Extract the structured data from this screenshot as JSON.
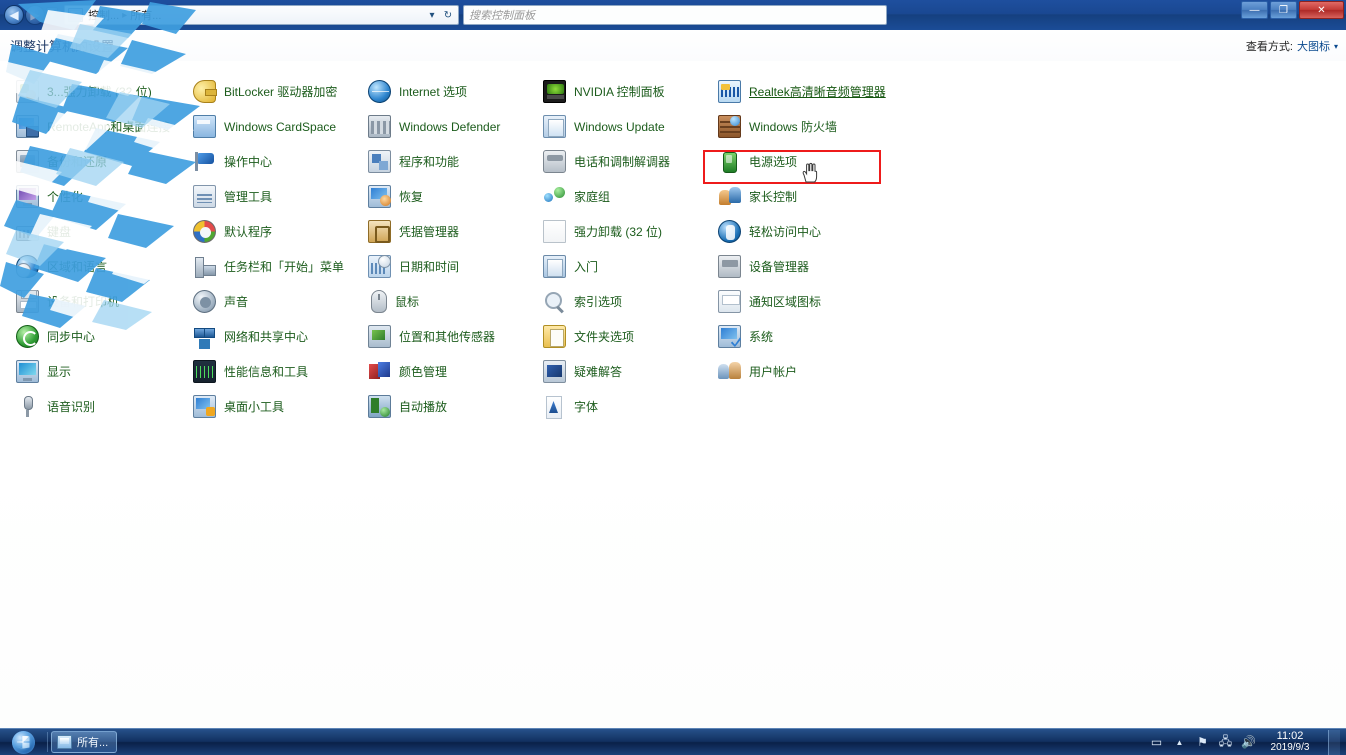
{
  "window": {
    "nav": {
      "back_icon": "back-arrow-icon",
      "forward_icon": "forward-arrow-icon",
      "recent_icon": "recent-pages-icon"
    },
    "breadcrumb": {
      "root": "控制...",
      "sep": "▸",
      "current": "所有..."
    },
    "search": {
      "placeholder": "搜索控制面板"
    },
    "controls": {
      "minimize": "—",
      "maximize": "❐",
      "close": "✕"
    }
  },
  "header": {
    "page_title": "调整计算机的设置",
    "view_by_label": "查看方式:",
    "view_by_value": "大图标",
    "view_by_caret": "▾"
  },
  "columns": [
    {
      "items": [
        {
          "label": "3...强力卸载 (32 位)",
          "icon": "uninstall-icon"
        },
        {
          "label": "RemoteApp和桌面连接",
          "icon": "remoteapp-icon"
        },
        {
          "label": "备份和还原",
          "icon": "backup-icon"
        },
        {
          "label": "个性化",
          "icon": "personalization-icon"
        },
        {
          "label": "键盘",
          "icon": "keyboard-icon"
        },
        {
          "label": "区域和语言",
          "icon": "region-language-icon"
        },
        {
          "label": "设备和打印机",
          "icon": "devices-printers-icon"
        },
        {
          "label": "同步中心",
          "icon": "sync-center-icon"
        },
        {
          "label": "显示",
          "icon": "display-icon"
        },
        {
          "label": "语音识别",
          "icon": "speech-recognition-icon"
        }
      ]
    },
    {
      "items": [
        {
          "label": "BitLocker 驱动器加密",
          "icon": "bitlocker-icon"
        },
        {
          "label": "Windows CardSpace",
          "icon": "cardspace-icon"
        },
        {
          "label": "操作中心",
          "icon": "action-center-icon"
        },
        {
          "label": "管理工具",
          "icon": "admin-tools-icon"
        },
        {
          "label": "默认程序",
          "icon": "default-programs-icon"
        },
        {
          "label": "任务栏和「开始」菜单",
          "icon": "taskbar-startmenu-icon"
        },
        {
          "label": "声音",
          "icon": "sound-icon"
        },
        {
          "label": "网络和共享中心",
          "icon": "network-sharing-icon"
        },
        {
          "label": "性能信息和工具",
          "icon": "performance-info-icon"
        },
        {
          "label": "桌面小工具",
          "icon": "desktop-gadgets-icon"
        }
      ]
    },
    {
      "items": [
        {
          "label": "Internet 选项",
          "icon": "internet-options-icon"
        },
        {
          "label": "Windows Defender",
          "icon": "windows-defender-icon"
        },
        {
          "label": "程序和功能",
          "icon": "programs-features-icon"
        },
        {
          "label": "恢复",
          "icon": "recovery-icon"
        },
        {
          "label": "凭据管理器",
          "icon": "credential-manager-icon"
        },
        {
          "label": "日期和时间",
          "icon": "date-time-icon"
        },
        {
          "label": "鼠标",
          "icon": "mouse-icon"
        },
        {
          "label": "位置和其他传感器",
          "icon": "location-sensors-icon"
        },
        {
          "label": "颜色管理",
          "icon": "color-management-icon"
        },
        {
          "label": "自动播放",
          "icon": "autoplay-icon"
        }
      ]
    },
    {
      "items": [
        {
          "label": "NVIDIA 控制面板",
          "icon": "nvidia-control-panel-icon"
        },
        {
          "label": "Windows Update",
          "icon": "windows-update-icon"
        },
        {
          "label": "电话和调制解调器",
          "icon": "phone-modem-icon"
        },
        {
          "label": "家庭组",
          "icon": "homegroup-icon"
        },
        {
          "label": "强力卸载 (32 位)",
          "icon": "uninstall-blank-icon"
        },
        {
          "label": "入门",
          "icon": "getting-started-icon"
        },
        {
          "label": "索引选项",
          "icon": "indexing-options-icon"
        },
        {
          "label": "文件夹选项",
          "icon": "folder-options-icon"
        },
        {
          "label": "疑难解答",
          "icon": "troubleshooting-icon"
        },
        {
          "label": "字体",
          "icon": "fonts-icon"
        }
      ]
    },
    {
      "items": [
        {
          "label": "Realtek高清晰音频管理器",
          "icon": "realtek-audio-icon",
          "highlighted": true
        },
        {
          "label": "Windows 防火墙",
          "icon": "windows-firewall-icon"
        },
        {
          "label": "电源选项",
          "icon": "power-options-icon"
        },
        {
          "label": "家长控制",
          "icon": "parental-controls-icon"
        },
        {
          "label": "轻松访问中心",
          "icon": "ease-of-access-icon"
        },
        {
          "label": "设备管理器",
          "icon": "device-manager-icon"
        },
        {
          "label": "通知区域图标",
          "icon": "notification-area-icon"
        },
        {
          "label": "系统",
          "icon": "system-icon"
        },
        {
          "label": "用户帐户",
          "icon": "user-accounts-icon"
        }
      ]
    }
  ],
  "taskbar": {
    "start_label": "start-orb",
    "buttons": [
      {
        "label": "所有...",
        "icon": "control-panel-icon"
      }
    ],
    "tray": {
      "overflow_caret": "▲",
      "icons": [
        "flag-action-center-icon",
        "network-icon",
        "volume-icon"
      ],
      "clock_time": "11:02",
      "clock_date": "2019/9/3"
    }
  },
  "annotation": {
    "highlight_color": "#ee1b1b",
    "highlight_target": "Realtek高清晰音频管理器"
  }
}
